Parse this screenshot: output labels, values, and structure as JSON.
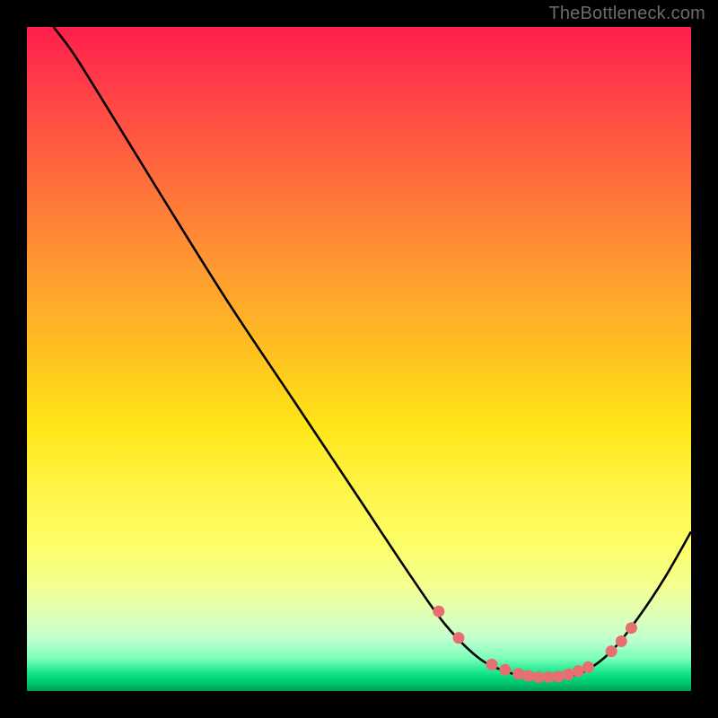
{
  "attribution": "TheBottleneck.com",
  "chart_data": {
    "type": "line",
    "title": "",
    "xlabel": "",
    "ylabel": "",
    "xlim": [
      0,
      100
    ],
    "ylim": [
      0,
      100
    ],
    "curve": [
      {
        "x": 4,
        "y": 100
      },
      {
        "x": 7,
        "y": 96
      },
      {
        "x": 12,
        "y": 88
      },
      {
        "x": 20,
        "y": 75
      },
      {
        "x": 30,
        "y": 59
      },
      {
        "x": 40,
        "y": 44
      },
      {
        "x": 50,
        "y": 29
      },
      {
        "x": 58,
        "y": 17
      },
      {
        "x": 63,
        "y": 10
      },
      {
        "x": 68,
        "y": 5
      },
      {
        "x": 72,
        "y": 3
      },
      {
        "x": 76,
        "y": 2
      },
      {
        "x": 80,
        "y": 2
      },
      {
        "x": 84,
        "y": 3
      },
      {
        "x": 88,
        "y": 6
      },
      {
        "x": 92,
        "y": 11
      },
      {
        "x": 96,
        "y": 17
      },
      {
        "x": 100,
        "y": 24
      }
    ],
    "markers": [
      {
        "x": 62,
        "y": 12
      },
      {
        "x": 65,
        "y": 8
      },
      {
        "x": 70,
        "y": 4
      },
      {
        "x": 72,
        "y": 3.2
      },
      {
        "x": 74,
        "y": 2.6
      },
      {
        "x": 75.5,
        "y": 2.3
      },
      {
        "x": 77,
        "y": 2.1
      },
      {
        "x": 78.5,
        "y": 2.1
      },
      {
        "x": 80,
        "y": 2.2
      },
      {
        "x": 81.5,
        "y": 2.5
      },
      {
        "x": 83,
        "y": 3.0
      },
      {
        "x": 84.5,
        "y": 3.6
      },
      {
        "x": 88,
        "y": 6
      },
      {
        "x": 89.5,
        "y": 7.5
      },
      {
        "x": 91,
        "y": 9.5
      }
    ],
    "marker_color": "#e86f71",
    "line_color": "#000000"
  }
}
